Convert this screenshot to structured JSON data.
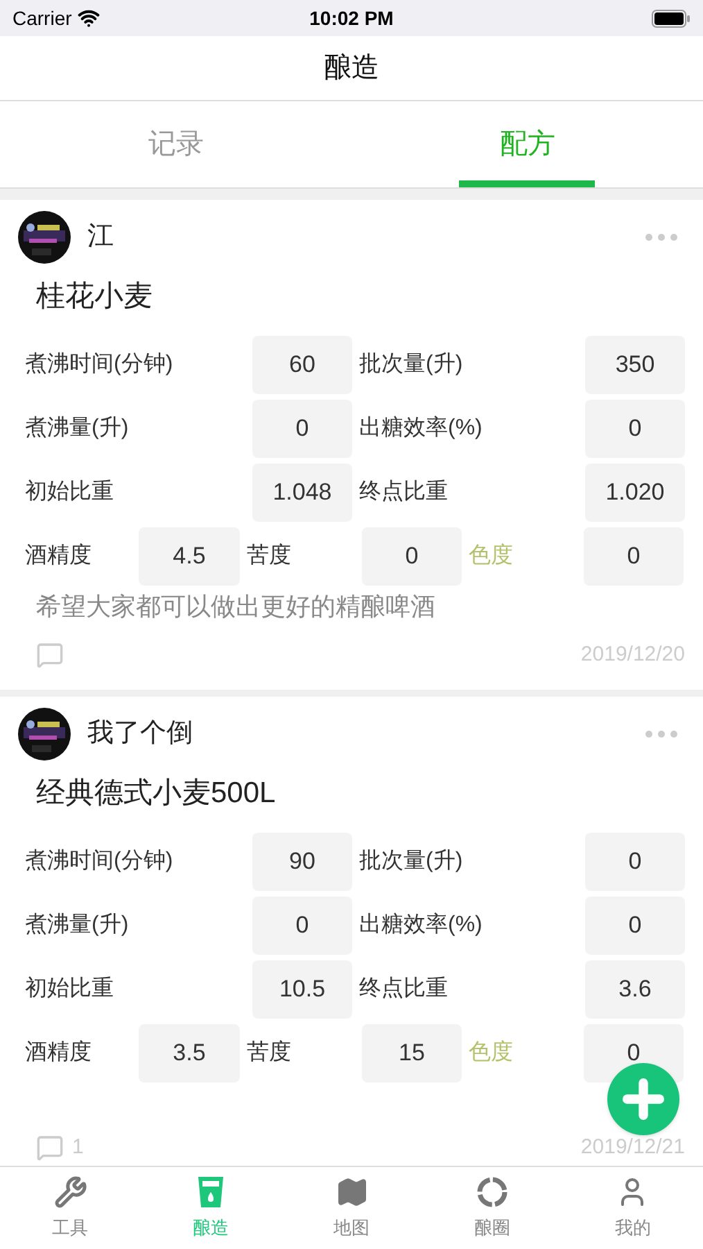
{
  "status_bar": {
    "carrier": "Carrier",
    "time": "10:02 PM"
  },
  "nav": {
    "title": "酿造"
  },
  "tabs": [
    {
      "label": "记录",
      "selected": false
    },
    {
      "label": "配方",
      "selected": true
    }
  ],
  "cards": [
    {
      "author": "江",
      "title": "桂花小麦",
      "stats": [
        [
          {
            "label": "煮沸时间(分钟)",
            "value": "60"
          },
          {
            "label": "批次量(升)",
            "value": "350"
          }
        ],
        [
          {
            "label": "煮沸量(升)",
            "value": "0"
          },
          {
            "label": "出糖效率(%)",
            "value": "0"
          }
        ],
        [
          {
            "label": "初始比重",
            "value": "1.048"
          },
          {
            "label": "终点比重",
            "value": "1.020"
          }
        ],
        [
          {
            "label": "酒精度",
            "value": "4.5",
            "faded": false
          },
          {
            "label": "苦度",
            "value": "0",
            "faded": false
          },
          {
            "label": "色度",
            "value": "0",
            "faded": true
          }
        ]
      ],
      "description": "希望大家都可以做出更好的精酿啤酒",
      "date": "2019/12/20"
    },
    {
      "author": "我了个倒",
      "title": "经典德式小麦500L",
      "stats": [
        [
          {
            "label": "煮沸时间(分钟)",
            "value": "90"
          },
          {
            "label": "批次量(升)",
            "value": "0"
          }
        ],
        [
          {
            "label": "煮沸量(升)",
            "value": "0"
          },
          {
            "label": "出糖效率(%)",
            "value": "0"
          }
        ],
        [
          {
            "label": "初始比重",
            "value": "10.5"
          },
          {
            "label": "终点比重",
            "value": "3.6"
          }
        ],
        [
          {
            "label": "酒精度",
            "value": "3.5",
            "faded": false
          },
          {
            "label": "苦度",
            "value": "15",
            "faded": false
          },
          {
            "label": "色度",
            "value": "0",
            "faded": true
          }
        ]
      ],
      "comments": "1",
      "date": "2019/12/21"
    }
  ],
  "bottom_tabs": [
    {
      "kind": "tools",
      "label": "工具",
      "selected": false
    },
    {
      "kind": "glass",
      "label": "酿造",
      "selected": true
    },
    {
      "kind": "map",
      "label": "地图",
      "selected": false
    },
    {
      "kind": "ring",
      "label": "酿圈",
      "selected": false
    },
    {
      "kind": "user",
      "label": "我的",
      "selected": false
    }
  ]
}
